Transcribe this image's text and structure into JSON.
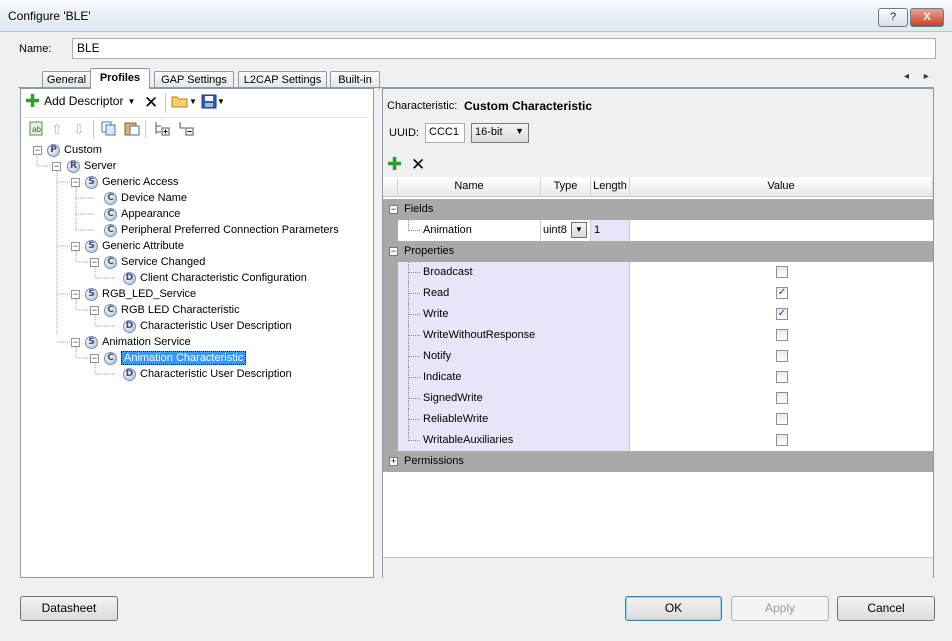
{
  "window": {
    "title": "Configure 'BLE'",
    "help": "?",
    "close": "X"
  },
  "name": {
    "label": "Name:",
    "value": "BLE"
  },
  "tabs": [
    "General",
    "Profiles",
    "GAP Settings",
    "L2CAP Settings",
    "Built-in"
  ],
  "tab_arrows": "◂ ▸",
  "left_toolbar": {
    "add_descriptor": "Add Descriptor"
  },
  "tree": [
    {
      "badge": "P",
      "label": "Custom"
    },
    {
      "badge": "R",
      "label": "Server"
    },
    {
      "badge": "S",
      "label": "Generic Access"
    },
    {
      "badge": "C",
      "label": "Device Name"
    },
    {
      "badge": "C",
      "label": "Appearance"
    },
    {
      "badge": "C",
      "label": "Peripheral Preferred Connection Parameters"
    },
    {
      "badge": "S",
      "label": "Generic Attribute"
    },
    {
      "badge": "C",
      "label": "Service Changed"
    },
    {
      "badge": "D",
      "label": "Client Characteristic Configuration"
    },
    {
      "badge": "S",
      "label": "RGB_LED_Service"
    },
    {
      "badge": "C",
      "label": "RGB LED Characteristic"
    },
    {
      "badge": "D",
      "label": "Characteristic User Description"
    },
    {
      "badge": "S",
      "label": "Animation Service"
    },
    {
      "badge": "C",
      "label": "Animation Characteristic"
    },
    {
      "badge": "D",
      "label": "Characteristic User Description"
    }
  ],
  "characteristic": {
    "label": "Characteristic:",
    "value": "Custom Characteristic"
  },
  "uuid": {
    "label": "UUID:",
    "value": "CCC1",
    "type": "16-bit"
  },
  "grid": {
    "headers": [
      "Name",
      "Type",
      "Length",
      "Value"
    ],
    "fields_label": "Fields",
    "field_row": {
      "name": "Animation",
      "type": "uint8",
      "length": "1"
    },
    "properties_label": "Properties",
    "properties": [
      {
        "name": "Broadcast",
        "checked": false
      },
      {
        "name": "Read",
        "checked": true
      },
      {
        "name": "Write",
        "checked": true
      },
      {
        "name": "WriteWithoutResponse",
        "checked": false
      },
      {
        "name": "Notify",
        "checked": false
      },
      {
        "name": "Indicate",
        "checked": false
      },
      {
        "name": "SignedWrite",
        "checked": false
      },
      {
        "name": "ReliableWrite",
        "checked": false
      },
      {
        "name": "WritableAuxiliaries",
        "checked": false
      }
    ],
    "permissions_label": "Permissions",
    "check_mark": "✓"
  },
  "buttons": {
    "datasheet": "Datasheet",
    "ok": "OK",
    "apply": "Apply",
    "cancel": "Cancel"
  }
}
